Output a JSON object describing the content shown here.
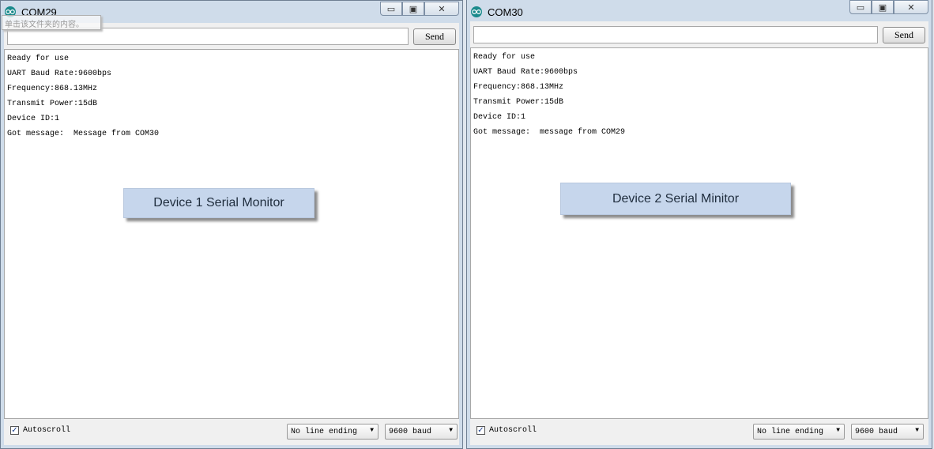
{
  "tooltip": {
    "text": "单击该文件夹的内容。"
  },
  "windows": [
    {
      "title": "COM29",
      "controls": {
        "minimize": "▭",
        "maximize": "▣",
        "close": "✕"
      },
      "send_label": "Send",
      "input_value": "",
      "output": [
        "Ready for use",
        "UART Baud Rate:9600bps",
        "Frequency:868.13MHz",
        "Transmit Power:15dB",
        "Device ID:1",
        "Got message:  Message from COM30"
      ],
      "caption": "Device 1 Serial Monitor",
      "autoscroll_label": "Autoscroll",
      "autoscroll_checked": true,
      "line_ending": "No line ending",
      "baud": "9600 baud"
    },
    {
      "title": "COM30",
      "controls": {
        "minimize": "▭",
        "maximize": "▣",
        "close": "✕"
      },
      "send_label": "Send",
      "input_value": "",
      "output": [
        "Ready for use",
        "UART Baud Rate:9600bps",
        "Frequency:868.13MHz",
        "Transmit Power:15dB",
        "Device ID:1",
        "Got message:  message from COM29"
      ],
      "caption": "Device 2 Serial Minitor",
      "autoscroll_label": "Autoscroll",
      "autoscroll_checked": true,
      "line_ending": "No line ending",
      "baud": "9600 baud"
    }
  ],
  "icons": {
    "app": "arduino-icon",
    "checkmark": "✓",
    "dropdown_arrow": "▼"
  },
  "colors": {
    "window_frame": "#cfdcea",
    "caption_box": "#c6d6ec",
    "app_icon": "#1a8a8c"
  }
}
